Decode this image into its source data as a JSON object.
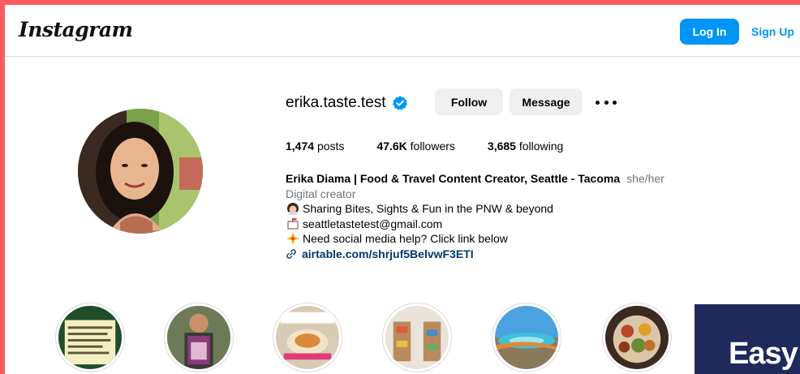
{
  "header": {
    "logo_text": "Instagram",
    "login_label": "Log In",
    "signup_label": "Sign Up"
  },
  "profile": {
    "username": "erika.taste.test",
    "verified_icon": "verified-badge-icon",
    "follow_label": "Follow",
    "message_label": "Message",
    "more_icon": "more-options-icon",
    "stats": {
      "posts_count": "1,474",
      "posts_label": "posts",
      "followers_count": "47.6K",
      "followers_label": "followers",
      "following_count": "3,685",
      "following_label": "following"
    },
    "bio": {
      "full_name": "Erika Diama | Food & Travel Content Creator, Seattle - Tacoma",
      "pronouns": "she/her",
      "category": "Digital creator",
      "line1": "Sharing Bites, Sights & Fun in the PNW & beyond",
      "line2": "seattletastetest@gmail.com",
      "line3": "Need social media help? Click link below",
      "link": "airtable.com/shrjuf5BelvwF3ETI"
    }
  },
  "ad": {
    "text": "Easy"
  },
  "colors": {
    "accent": "#0095f6",
    "button_gray": "#efefef",
    "frame": "#ff5a5f",
    "link": "#00376b"
  }
}
